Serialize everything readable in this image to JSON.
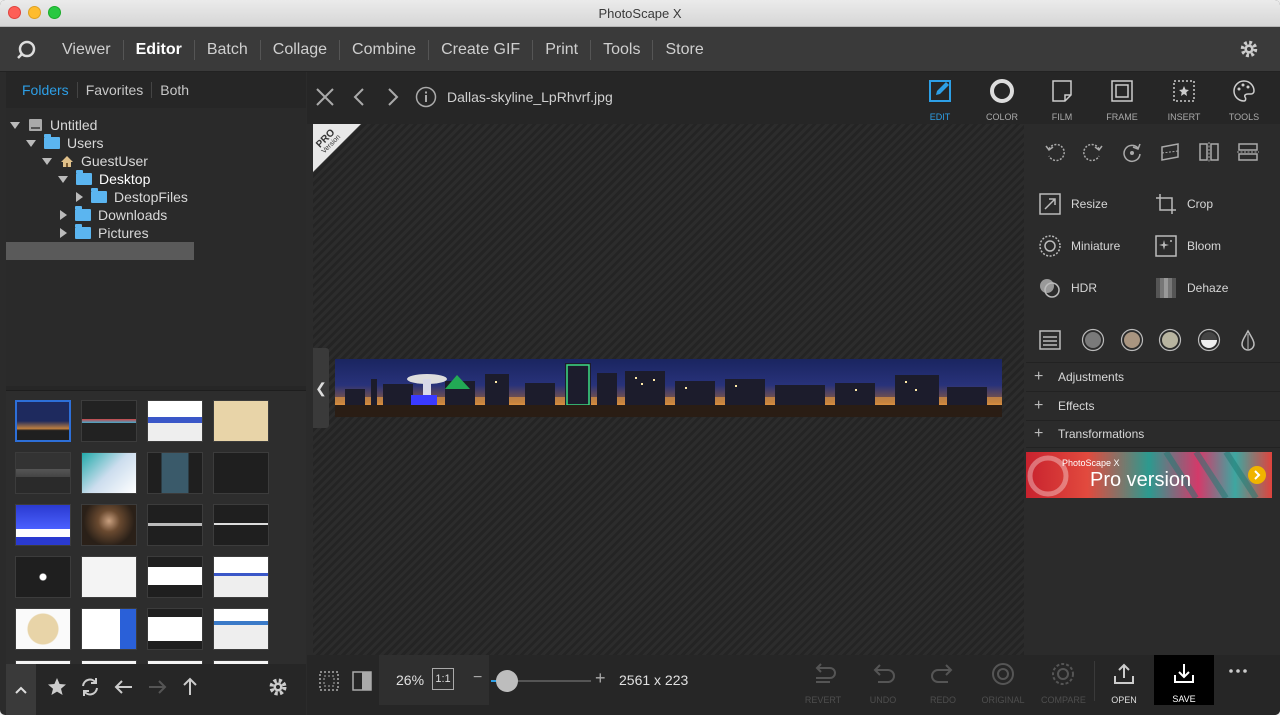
{
  "window": {
    "title": "PhotoScape X"
  },
  "menu": {
    "items": [
      {
        "label": "Viewer",
        "active": false
      },
      {
        "label": "Editor",
        "active": true
      },
      {
        "label": "Batch",
        "active": false
      },
      {
        "label": "Collage",
        "active": false
      },
      {
        "label": "Combine",
        "active": false
      },
      {
        "label": "Create GIF",
        "active": false
      },
      {
        "label": "Print",
        "active": false
      },
      {
        "label": "Tools",
        "active": false
      },
      {
        "label": "Store",
        "active": false
      }
    ]
  },
  "sidebar": {
    "tabs": [
      {
        "label": "Folders",
        "active": true
      },
      {
        "label": "Favorites",
        "active": false
      },
      {
        "label": "Both",
        "active": false
      }
    ],
    "tree": [
      {
        "label": "Untitled",
        "icon": "disk-icon"
      },
      {
        "label": "Users",
        "icon": "folder-icon"
      },
      {
        "label": "GuestUser",
        "icon": "home-icon"
      },
      {
        "label": "Desktop",
        "icon": "folder-icon",
        "selected": true
      },
      {
        "label": "DestopFiles",
        "icon": "folder-icon"
      },
      {
        "label": "Downloads",
        "icon": "folder-icon"
      },
      {
        "label": "Pictures",
        "icon": "folder-icon"
      }
    ]
  },
  "viewer": {
    "filename": "Dallas-skyline_LpRhvrf.jpg",
    "badge": {
      "line1": "PRO",
      "line2": "Version"
    }
  },
  "tabs": [
    {
      "label": "EDIT",
      "active": true
    },
    {
      "label": "COLOR"
    },
    {
      "label": "FILM"
    },
    {
      "label": "FRAME"
    },
    {
      "label": "INSERT"
    },
    {
      "label": "TOOLS"
    }
  ],
  "tools": [
    {
      "label": "Resize"
    },
    {
      "label": "Crop"
    },
    {
      "label": "Miniature"
    },
    {
      "label": "Bloom"
    },
    {
      "label": "HDR"
    },
    {
      "label": "Dehaze"
    }
  ],
  "sections": [
    {
      "label": "Adjustments"
    },
    {
      "label": "Effects"
    },
    {
      "label": "Transformations"
    }
  ],
  "ad": {
    "brand": "PhotoScape X",
    "text": "Pro version"
  },
  "statusbar": {
    "zoom": "26%",
    "ratio": "1:1",
    "dimensions": "2561 x 223",
    "zoom_level": 0.1
  },
  "actions": [
    {
      "label": "REVERT"
    },
    {
      "label": "UNDO"
    },
    {
      "label": "REDO"
    },
    {
      "label": "ORIGINAL"
    },
    {
      "label": "COMPARE"
    },
    {
      "label": "OPEN"
    },
    {
      "label": "SAVE"
    }
  ],
  "colors": {
    "accent": "#2d9fe6",
    "background": "#2b2b2b"
  }
}
